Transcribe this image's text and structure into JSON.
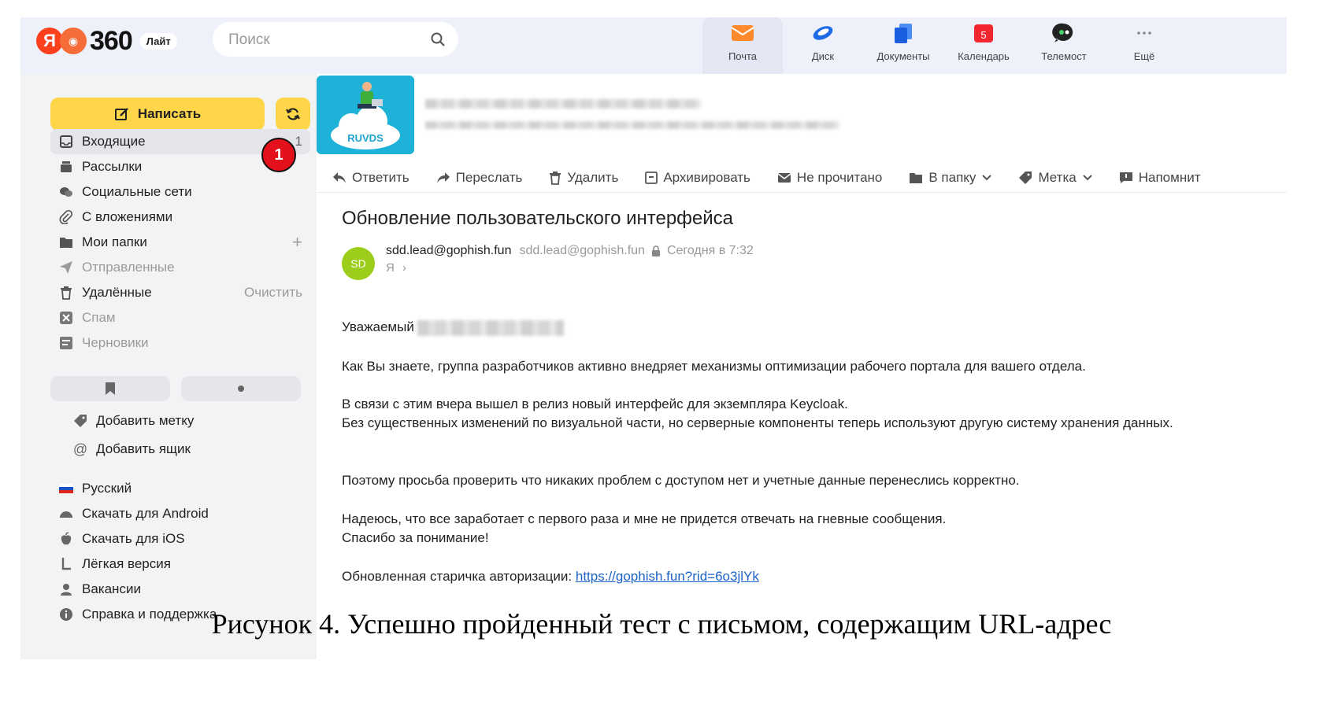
{
  "header": {
    "logo_text": "360",
    "logo_badge": "Лайт",
    "search_placeholder": "Поиск",
    "services": [
      {
        "label": "Почта",
        "icon": "mail-icon",
        "active": true
      },
      {
        "label": "Диск",
        "icon": "disk-icon"
      },
      {
        "label": "Документы",
        "icon": "documents-icon"
      },
      {
        "label": "Календарь",
        "icon": "calendar-icon",
        "badge": "5"
      },
      {
        "label": "Телемост",
        "icon": "telemost-icon"
      },
      {
        "label": "Ещё",
        "icon": "more-icon"
      }
    ]
  },
  "sidebar": {
    "compose_label": "Написать",
    "folders": [
      {
        "label": "Входящие",
        "count": "1",
        "icon": "inbox-icon"
      },
      {
        "label": "Рассылки",
        "icon": "newsletters-icon"
      },
      {
        "label": "Социальные сети",
        "icon": "social-icon"
      },
      {
        "label": "С вложениями",
        "icon": "attachment-icon"
      },
      {
        "label": "Мои папки",
        "icon": "folder-icon",
        "action": "+"
      },
      {
        "label": "Отправленные",
        "icon": "sent-icon"
      },
      {
        "label": "Удалённые",
        "icon": "trash-icon",
        "action": "Очистить"
      },
      {
        "label": "Спам",
        "icon": "spam-icon"
      },
      {
        "label": "Черновики",
        "icon": "drafts-icon"
      }
    ],
    "marker_number": "1",
    "add_label": "Добавить метку",
    "add_mailbox": "Добавить ящик",
    "footer": [
      {
        "label": "Русский",
        "icon": "russian-flag-icon"
      },
      {
        "label": "Скачать для Android",
        "icon": "android-icon"
      },
      {
        "label": "Скачать для iOS",
        "icon": "apple-icon"
      },
      {
        "label": "Лёгкая версия",
        "icon": "light-version-icon"
      },
      {
        "label": "Вакансии",
        "icon": "vacancies-icon"
      },
      {
        "label": "Справка и поддержка",
        "icon": "help-icon"
      }
    ]
  },
  "banner": {
    "logo_text": "RUVDS"
  },
  "toolbar": {
    "reply": "Ответить",
    "forward": "Переслать",
    "delete": "Удалить",
    "archive": "Архивировать",
    "unread": "Не прочитано",
    "to_folder": "В папку",
    "label": "Метка",
    "remind": "Напомнит"
  },
  "message": {
    "subject": "Обновление пользовательского интерфейса",
    "avatar": "SD",
    "sender_name": "sdd.lead@gophish.fun",
    "sender_address": "sdd.lead@gophish.fun",
    "date": "Сегодня в 7:32",
    "to": "Я",
    "greeting": "Уважаемый",
    "p1": "Как Вы знаете, группа разработчиков активно внедряет механизмы оптимизации рабочего портала для вашего отдела.",
    "p2a": "В связи с этим вчера вышел в релиз новый интерфейс для экземпляра Keycloak.",
    "p2b": "Без существенных изменений по визуальной части, но серверные компоненты теперь используют другую систему хранения данных.",
    "p3": "Поэтому просьба проверить что никаких проблем с доступом нет и учетные данные перенеслись корректно.",
    "p4a": "Надеюсь, что все заработает с первого раза и мне не придется отвечать на гневные сообщения.",
    "p4b": "Спасибо за понимание!",
    "link_prefix": "Обновленная старичка авторизации:",
    "link_url": "https://gophish.fun?rid=6o3jlYk"
  },
  "caption": "Рисунок 4. Успешно пройденный тест с письмом, содержащим URL-адрес",
  "colors": {
    "compose": "#ffd64a",
    "marker": "#e3111b",
    "link": "#1a63c8",
    "avatar": "#9ccd1a"
  }
}
